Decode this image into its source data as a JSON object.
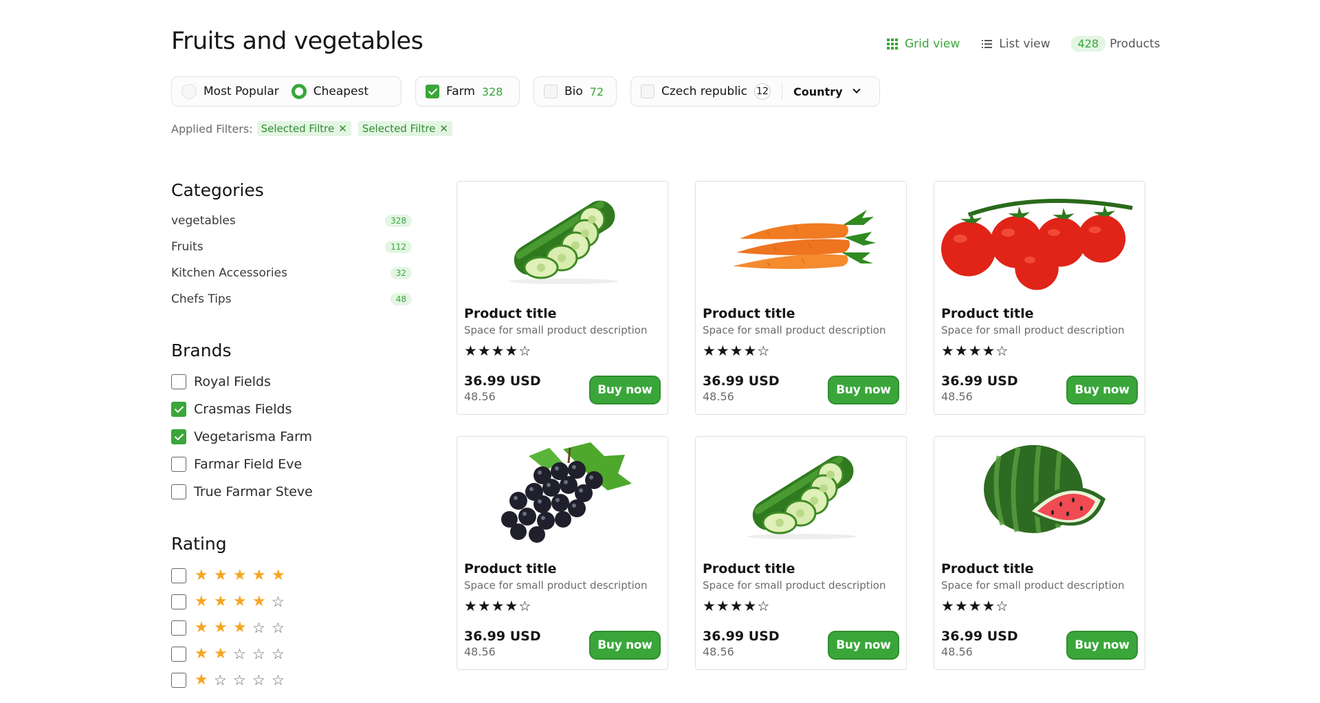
{
  "page_title": "Fruits and vegetables",
  "view": {
    "grid_label": "Grid view",
    "list_label": "List view",
    "product_count": "428",
    "products_label": "Products"
  },
  "sort": {
    "options": [
      "Most Popular",
      "Cheapest"
    ],
    "selected": "Cheapest"
  },
  "filters": {
    "farm": {
      "label": "Farm",
      "count": "328",
      "checked": true
    },
    "bio": {
      "label": "Bio",
      "count": "72",
      "checked": false
    },
    "origin": {
      "label": "Czech republic",
      "count": "12",
      "checked": false,
      "select_label": "Country"
    }
  },
  "applied": {
    "label": "Applied Filters:",
    "tags": [
      "Selected Filtre",
      "Selected Filtre"
    ]
  },
  "categories": {
    "title": "Categories",
    "items": [
      {
        "label": "vegetables",
        "count": "328"
      },
      {
        "label": "Fruits",
        "count": "112"
      },
      {
        "label": "Kitchen Accessories",
        "count": "32"
      },
      {
        "label": "Chefs Tips",
        "count": "48"
      }
    ]
  },
  "brands": {
    "title": "Brands",
    "items": [
      {
        "label": "Royal Fields",
        "checked": false
      },
      {
        "label": "Crasmas Fields",
        "checked": true
      },
      {
        "label": "Vegetarisma Farm",
        "checked": true
      },
      {
        "label": "Farmar Field Eve",
        "checked": false
      },
      {
        "label": "True Farmar Steve",
        "checked": false
      }
    ]
  },
  "rating": {
    "title": "Rating",
    "levels": [
      5,
      4,
      3,
      2,
      1
    ]
  },
  "products": [
    {
      "image": "cucumber",
      "title": "Product title",
      "description": "Space for small product description",
      "rating": 4,
      "price": "36.99 USD",
      "old_price": "48.56",
      "buy_label": "Buy now"
    },
    {
      "image": "carrot",
      "title": "Product title",
      "description": "Space for small product description",
      "rating": 4,
      "price": "36.99 USD",
      "old_price": "48.56",
      "buy_label": "Buy now"
    },
    {
      "image": "tomato",
      "title": "Product title",
      "description": "Space for small product description",
      "rating": 4,
      "price": "36.99 USD",
      "old_price": "48.56",
      "buy_label": "Buy now"
    },
    {
      "image": "grapes",
      "title": "Product title",
      "description": "Space for small product description",
      "rating": 4,
      "price": "36.99 USD",
      "old_price": "48.56",
      "buy_label": "Buy now"
    },
    {
      "image": "cucumber",
      "title": "Product title",
      "description": "Space for small product description",
      "rating": 4,
      "price": "36.99 USD",
      "old_price": "48.56",
      "buy_label": "Buy now"
    },
    {
      "image": "watermelon",
      "title": "Product title",
      "description": "Space for small product description",
      "rating": 4,
      "price": "36.99 USD",
      "old_price": "48.56",
      "buy_label": "Buy now"
    }
  ],
  "colors": {
    "accent": "#3aa63a",
    "accent_light": "#e4f5e4",
    "star": "#f5a623",
    "text": "#151515",
    "muted": "#6b6b6b"
  }
}
